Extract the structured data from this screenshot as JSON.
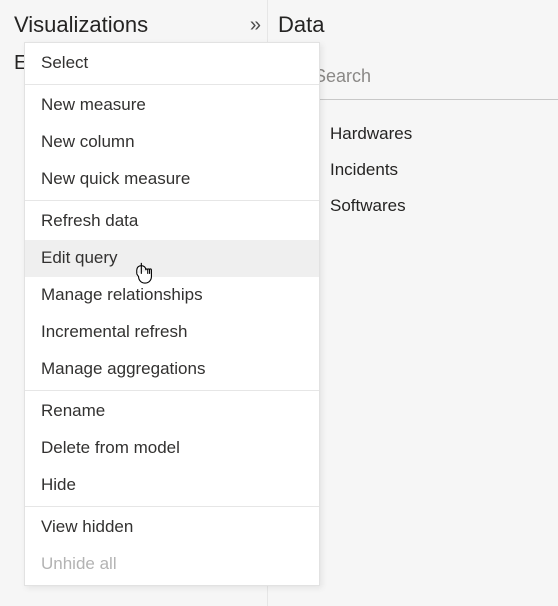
{
  "viz": {
    "title": "Visualizations",
    "build_letter": "E"
  },
  "data": {
    "title": "Data",
    "search_placeholder": "Search",
    "tables": [
      {
        "label": "Hardwares"
      },
      {
        "label": "Incidents"
      },
      {
        "label": "Softwares"
      }
    ]
  },
  "menu": {
    "items": [
      {
        "label": "Select"
      },
      {
        "label": "New measure"
      },
      {
        "label": "New column"
      },
      {
        "label": "New quick measure"
      },
      {
        "label": "Refresh data"
      },
      {
        "label": "Edit query",
        "hovered": true
      },
      {
        "label": "Manage relationships"
      },
      {
        "label": "Incremental refresh"
      },
      {
        "label": "Manage aggregations"
      },
      {
        "label": "Rename"
      },
      {
        "label": "Delete from model"
      },
      {
        "label": "Hide"
      },
      {
        "label": "View hidden"
      },
      {
        "label": "Unhide all",
        "disabled": true
      }
    ]
  }
}
